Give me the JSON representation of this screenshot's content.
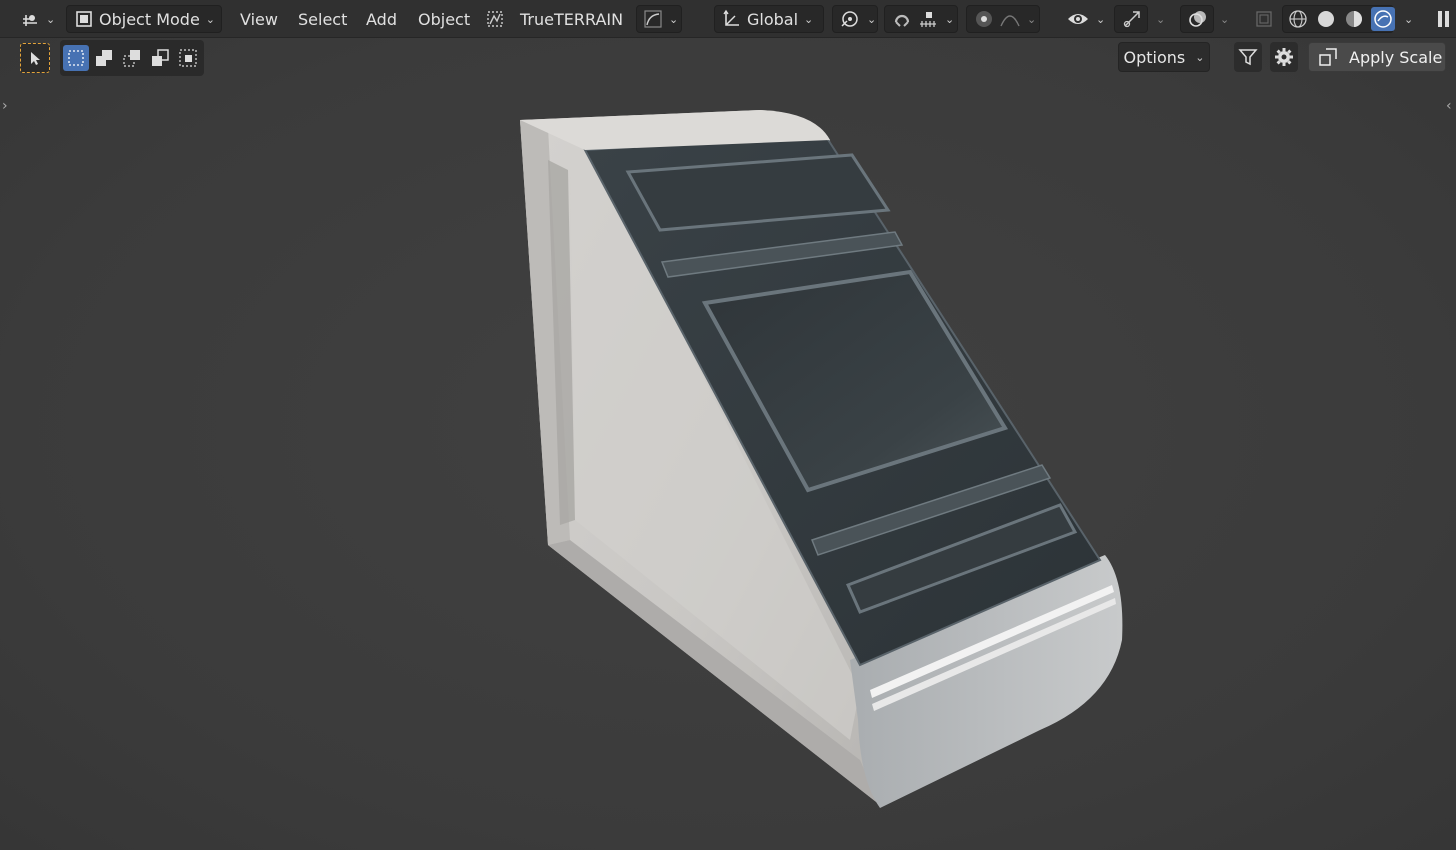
{
  "header": {
    "editor_type_icon": "axis-grid-icon",
    "mode_label": "Object Mode",
    "menus": [
      "View",
      "Select",
      "Add",
      "Object"
    ],
    "addon_label": "TrueTERRAIN",
    "orientation_label": "Global"
  },
  "toolbar": {
    "options_label": "Options",
    "apply_scale_label": "Apply Scale"
  },
  "colors": {
    "header_bg": "#303030",
    "viewport_bg": "#3d3d3d",
    "accent_blue": "#4772b3",
    "select_orange": "#e3a33a"
  }
}
